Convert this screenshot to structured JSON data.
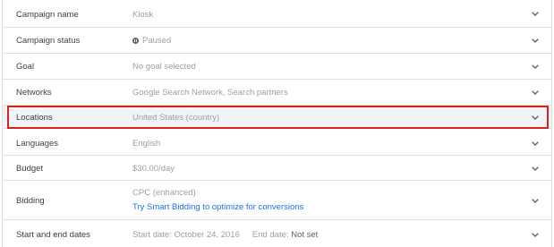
{
  "settings": {
    "rows": [
      {
        "label": "Campaign name",
        "value": "Kiosk"
      },
      {
        "label": "Campaign status",
        "value": "Paused",
        "icon": "pause-circle-icon"
      },
      {
        "label": "Goal",
        "value": "No goal selected"
      },
      {
        "label": "Networks",
        "value": "Google Search Network, Search partners"
      },
      {
        "label": "Locations",
        "value": "United States (country)",
        "highlighted": true
      },
      {
        "label": "Languages",
        "value": "English"
      },
      {
        "label": "Budget",
        "value": "$30.00/day"
      },
      {
        "label": "Bidding",
        "value": "CPC (enhanced)",
        "link": "Try Smart Bidding to optimize for conversions"
      },
      {
        "label": "Start and end dates",
        "start": "Start date: October 24, 2016",
        "end_label": "End date:",
        "end_value": "Not set"
      }
    ],
    "expand_icon": "chevron-down-icon"
  },
  "colors": {
    "highlight": "#e0201e",
    "link": "#1a73e8",
    "divider": "#e0e0e0"
  }
}
